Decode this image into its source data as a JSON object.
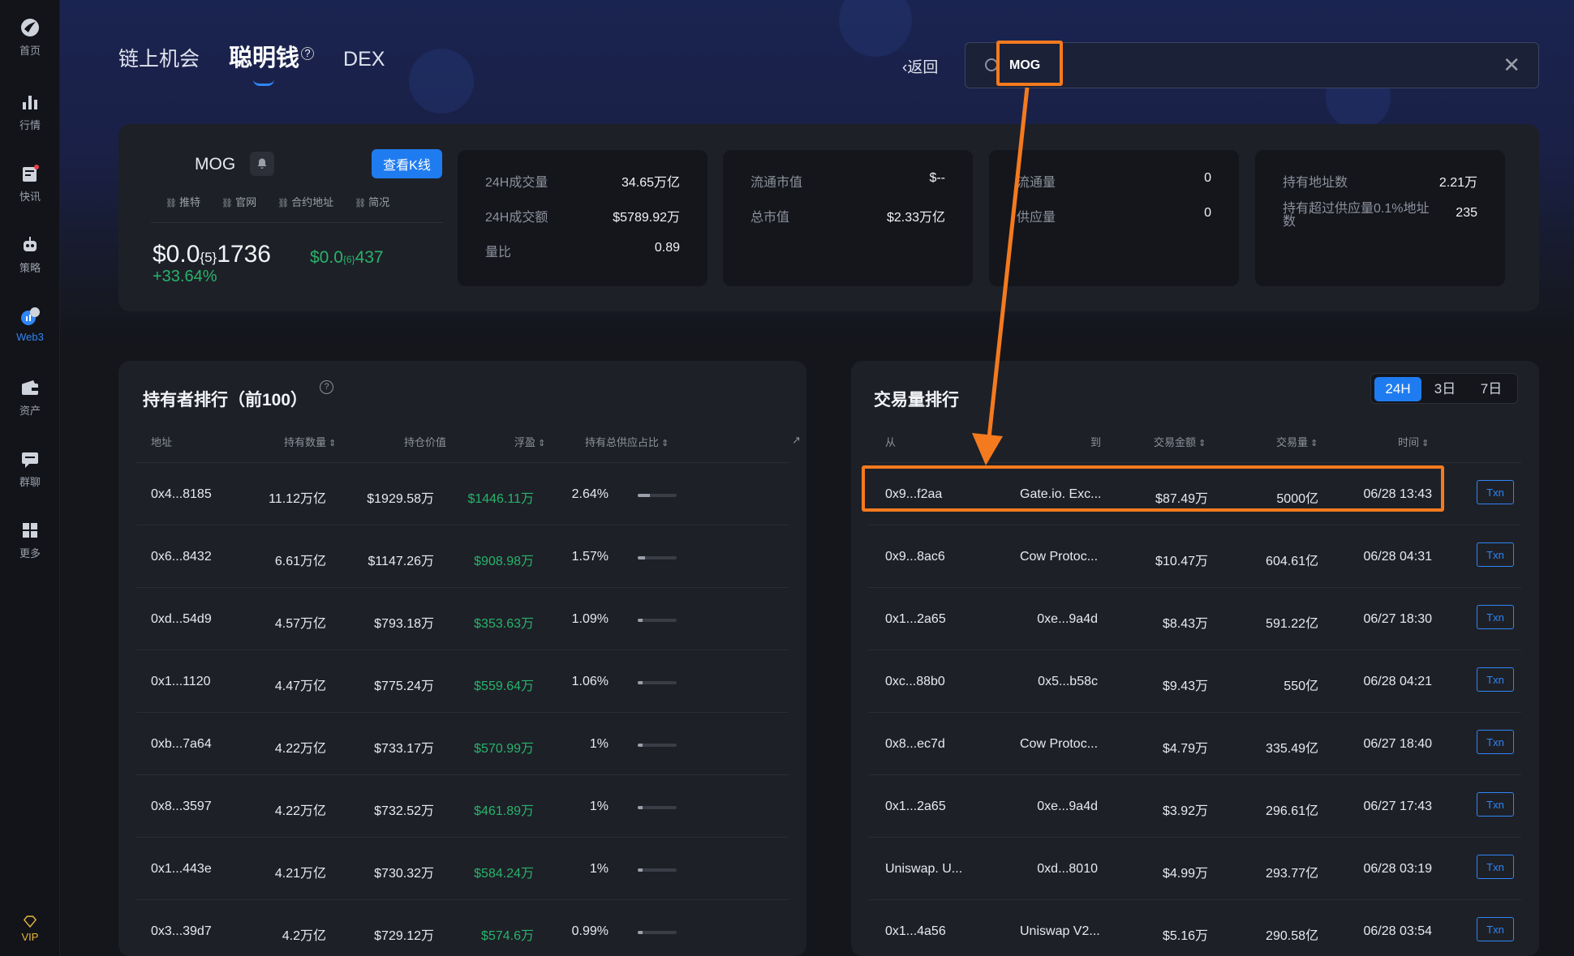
{
  "sidebar": {
    "items": [
      {
        "label": "首页",
        "icon": "home-logo-icon"
      },
      {
        "label": "行情",
        "icon": "bar-chart-icon"
      },
      {
        "label": "快讯",
        "icon": "news-icon"
      },
      {
        "label": "策略",
        "icon": "robot-icon"
      },
      {
        "label": "Web3",
        "icon": "web3-icon",
        "active": true
      },
      {
        "label": "资产",
        "icon": "wallet-icon"
      },
      {
        "label": "群聊",
        "icon": "chat-icon"
      },
      {
        "label": "更多",
        "icon": "grid-icon"
      }
    ],
    "vip_label": "VIP"
  },
  "nav": {
    "tabs": [
      {
        "label": "链上机会"
      },
      {
        "label": "聪明钱",
        "active": true
      },
      {
        "label": "DEX"
      }
    ],
    "help_glyph": "?"
  },
  "header": {
    "back_label": "返回",
    "search_value": "MOG",
    "close_glyph": "✕"
  },
  "token": {
    "name": "MOG",
    "kline_label": "查看K线",
    "links": [
      "推特",
      "官网",
      "合约地址",
      "简况"
    ],
    "price_prefix": "$0.0",
    "price_sub": "{5}",
    "price_suffix": "1736",
    "price2_prefix": "$0.0",
    "price2_sub": "{6}",
    "price2_suffix": "437",
    "change": "+33.64%"
  },
  "stats": [
    [
      {
        "label": "24H成交量",
        "value": "34.65万亿"
      },
      {
        "label": "24H成交额",
        "value": "$5789.92万"
      },
      {
        "label": "量比",
        "value": "0.89"
      }
    ],
    [
      {
        "label": "流通市值",
        "value": "$--"
      },
      {
        "label": "总市值",
        "value": "$2.33万亿"
      }
    ],
    [
      {
        "label": "流通量",
        "value": "0"
      },
      {
        "label": "供应量",
        "value": "0"
      }
    ],
    [
      {
        "label": "持有地址数",
        "value": "2.21万"
      },
      {
        "label": "持有超过供应量0.1%地址数",
        "value": "235"
      }
    ]
  ],
  "holders": {
    "title": "持有者排行（前100）",
    "columns": [
      "地址",
      "持有数量",
      "持仓价值",
      "浮盈",
      "持有总供应占比"
    ],
    "rows": [
      {
        "addr": "0x4...8185",
        "amount": "11.12万亿",
        "value": "$1929.58万",
        "pnl": "$1446.11万",
        "pct": "2.64%",
        "share": 0.264
      },
      {
        "addr": "0x6...8432",
        "amount": "6.61万亿",
        "value": "$1147.26万",
        "pnl": "$908.98万",
        "pct": "1.57%",
        "share": 0.157
      },
      {
        "addr": "0xd...54d9",
        "amount": "4.57万亿",
        "value": "$793.18万",
        "pnl": "$353.63万",
        "pct": "1.09%",
        "share": 0.109
      },
      {
        "addr": "0x1...1120",
        "amount": "4.47万亿",
        "value": "$775.24万",
        "pnl": "$559.64万",
        "pct": "1.06%",
        "share": 0.106
      },
      {
        "addr": "0xb...7a64",
        "amount": "4.22万亿",
        "value": "$733.17万",
        "pnl": "$570.99万",
        "pct": "1%",
        "share": 0.1
      },
      {
        "addr": "0x8...3597",
        "amount": "4.22万亿",
        "value": "$732.52万",
        "pnl": "$461.89万",
        "pct": "1%",
        "share": 0.1
      },
      {
        "addr": "0x1...443e",
        "amount": "4.21万亿",
        "value": "$730.32万",
        "pnl": "$584.24万",
        "pct": "1%",
        "share": 0.1
      },
      {
        "addr": "0x3...39d7",
        "amount": "4.2万亿",
        "value": "$729.12万",
        "pnl": "$574.6万",
        "pct": "0.99%",
        "share": 0.099
      }
    ]
  },
  "volume": {
    "title": "交易量排行",
    "ranges": [
      "24H",
      "3日",
      "7日"
    ],
    "columns": [
      "从",
      "到",
      "交易金额",
      "交易量",
      "时间"
    ],
    "txn_label": "Txn",
    "rows": [
      {
        "from": "0x9...f2aa",
        "to": "Gate.io. Exc...",
        "amount": "$87.49万",
        "qty": "5000亿",
        "time": "06/28 13:43",
        "to_left": true
      },
      {
        "from": "0x9...8ac6",
        "to": "Cow Protoc...",
        "amount": "$10.47万",
        "qty": "604.61亿",
        "time": "06/28 04:31",
        "to_left": true
      },
      {
        "from": "0x1...2a65",
        "to": "0xe...9a4d",
        "amount": "$8.43万",
        "qty": "591.22亿",
        "time": "06/27 18:30",
        "to_left": false
      },
      {
        "from": "0xc...88b0",
        "to": "0x5...b58c",
        "amount": "$9.43万",
        "qty": "550亿",
        "time": "06/28 04:21",
        "to_left": false
      },
      {
        "from": "0x8...ec7d",
        "to": "Cow Protoc...",
        "amount": "$4.79万",
        "qty": "335.49亿",
        "time": "06/27 18:40",
        "to_left": true
      },
      {
        "from": "0x1...2a65",
        "to": "0xe...9a4d",
        "amount": "$3.92万",
        "qty": "296.61亿",
        "time": "06/27 17:43",
        "to_left": false
      },
      {
        "from": "Uniswap. U...",
        "to": "0xd...8010",
        "amount": "$4.99万",
        "qty": "293.77亿",
        "time": "06/28 03:19",
        "to_left": false
      },
      {
        "from": "0x1...4a56",
        "to": "Uniswap V2...",
        "amount": "$5.16万",
        "qty": "290.58亿",
        "time": "06/28 03:54",
        "to_left": true
      }
    ]
  },
  "colors": {
    "accent": "#1f7cf0",
    "positive": "#27b36b",
    "highlight": "#f47a1f"
  }
}
